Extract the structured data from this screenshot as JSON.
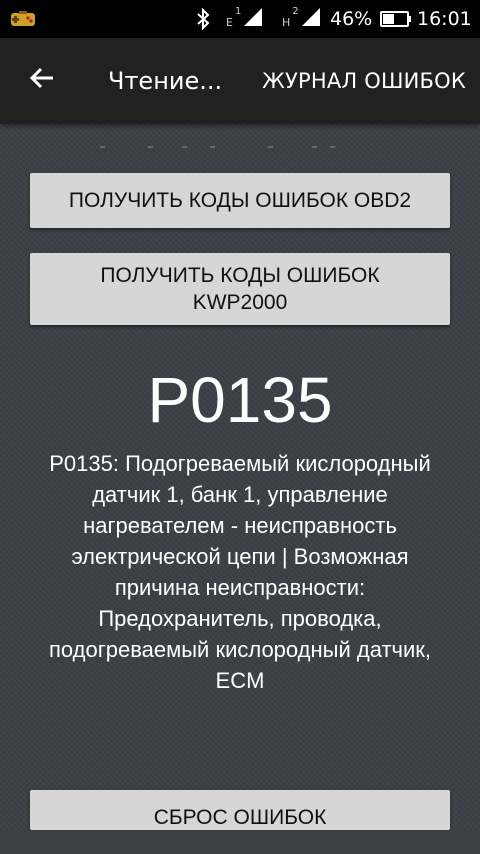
{
  "status_bar": {
    "notification_icon": "game-controller-icon",
    "bluetooth_icon": "bluetooth-icon",
    "sim1": {
      "letter": "E",
      "number": "1",
      "icon": "signal-icon"
    },
    "sim2": {
      "letter": "H",
      "number": "2",
      "icon": "signal-icon"
    },
    "battery_percent": "46%",
    "battery_level": 0.46,
    "battery_icon": "battery-icon",
    "time": "16:01"
  },
  "app_bar": {
    "back_icon": "arrow-left-icon",
    "title": "Чтение...",
    "log_button": "ЖУРНАЛ ОШИБОК"
  },
  "main": {
    "obd2_button": "ПОЛУЧИТЬ КОДЫ ОШИБОК OBD2",
    "kwp_button_line1": "ПОЛУЧИТЬ КОДЫ ОШИБОК",
    "kwp_button_line2": "KWP2000",
    "error_code": "P0135",
    "error_description": "P0135: Подогреваемый кислородный датчик 1, банк 1, управление нагревателем - неисправность электрической цепи | Возможная причина неисправности: Предохранитель, проводка, подогреваемый кислородный датчик, ECM",
    "reset_button": "СБРОС ОШИБОК"
  }
}
